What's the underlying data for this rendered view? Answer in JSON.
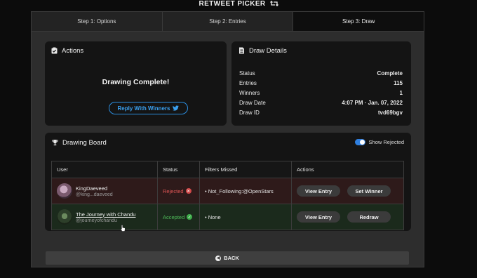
{
  "app": {
    "title": "RETWEET PICKER"
  },
  "steps": [
    {
      "label": "Step 1: Options"
    },
    {
      "label": "Step 2: Entries"
    },
    {
      "label": "Step 3: Draw"
    }
  ],
  "actions": {
    "title": "Actions",
    "message": "Drawing Complete!",
    "reply_label": "Reply With Winners"
  },
  "details": {
    "title": "Draw Details",
    "rows": [
      {
        "label": "Status",
        "value": "Complete"
      },
      {
        "label": "Entries",
        "value": "115"
      },
      {
        "label": "Winners",
        "value": "1"
      },
      {
        "label": "Draw Date",
        "value": "4:07 PM · Jan. 07, 2022"
      },
      {
        "label": "Draw ID",
        "value": "tvd69bgv"
      }
    ]
  },
  "board": {
    "title": "Drawing Board",
    "toggle_label": "Show Rejected",
    "toggle_on": true,
    "columns": [
      "User",
      "Status",
      "Filters Missed",
      "Actions"
    ],
    "rows": [
      {
        "name": "KingDaeveed",
        "handle": "@king...daeveed",
        "status": "Rejected",
        "filters": "• Not_Following:@OpenStars",
        "btn1": "View Entry",
        "btn2": "Set Winner"
      },
      {
        "name": "The Journey with Chandu",
        "handle": "@journeyofchandu",
        "status": "Accepted",
        "filters": "• None",
        "btn1": "View Entry",
        "btn2": "Redraw"
      }
    ]
  },
  "back_label": "BACK",
  "colors": {
    "accent_blue": "#2f7fe0",
    "rejected": "#e05555",
    "accepted": "#4fbf5a"
  }
}
